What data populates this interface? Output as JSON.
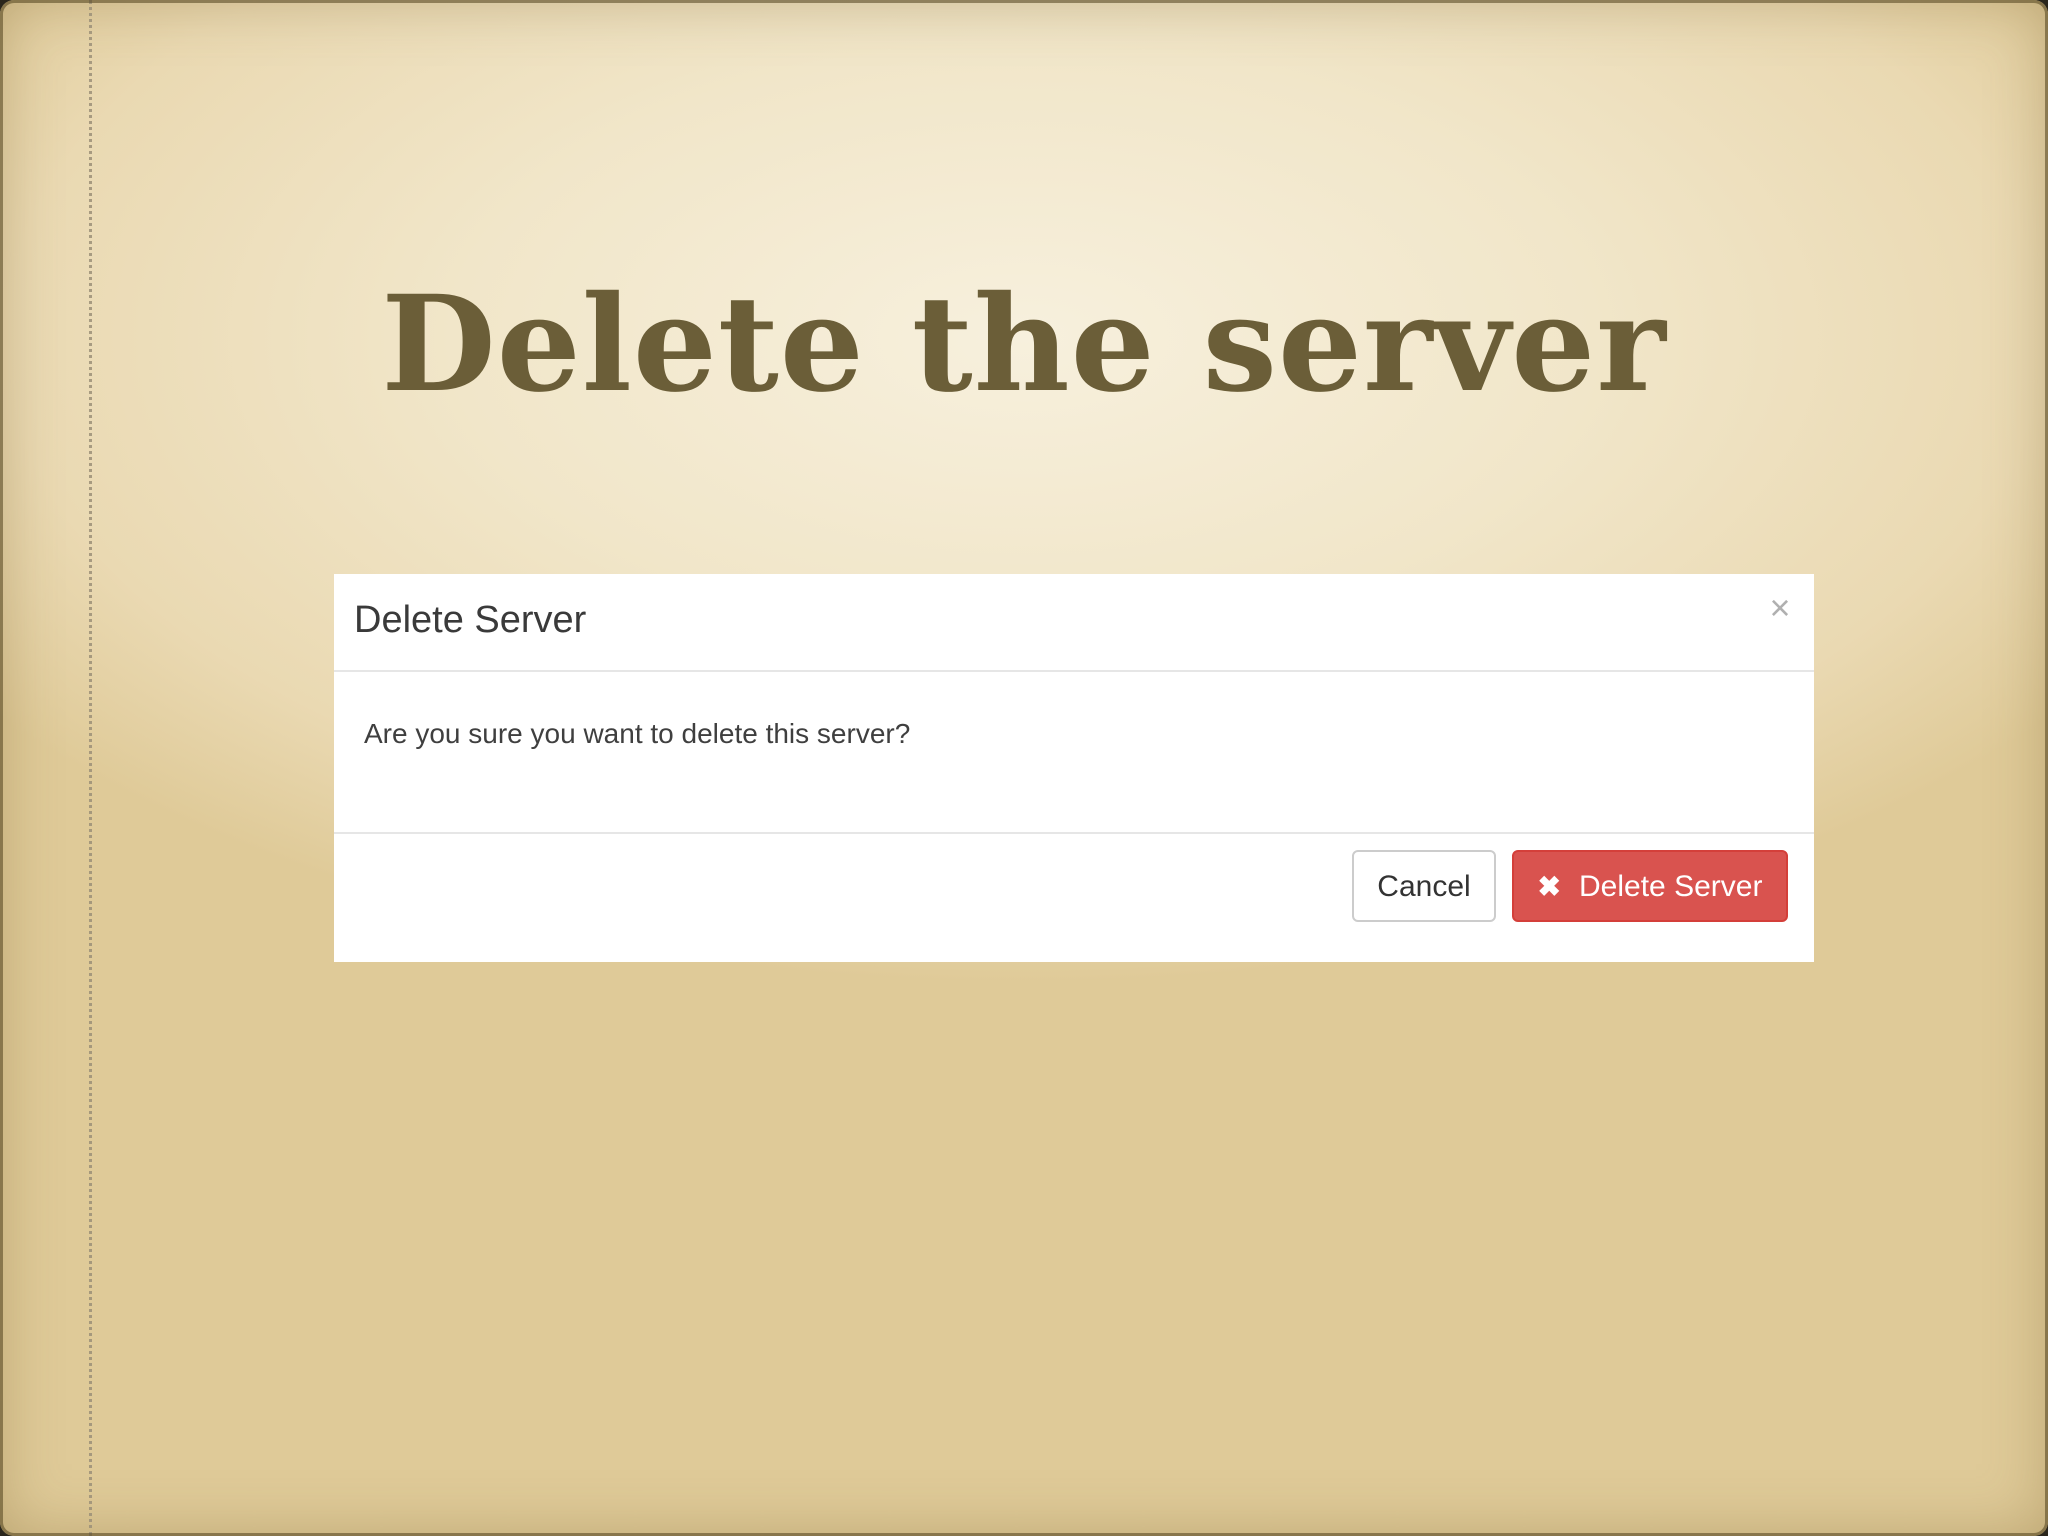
{
  "slide": {
    "title": "Delete the server"
  },
  "modal": {
    "title": "Delete Server",
    "close_glyph": "×",
    "message": "Are you sure you want to delete this server?",
    "cancel_label": "Cancel",
    "delete_label": "Delete Server",
    "delete_icon_glyph": "✖"
  },
  "colors": {
    "slide_title": "#6b5e38",
    "danger_button": "#d9534f",
    "background": "#f1e6c9"
  },
  "icons": {
    "close": "close-icon",
    "delete": "times-icon"
  }
}
